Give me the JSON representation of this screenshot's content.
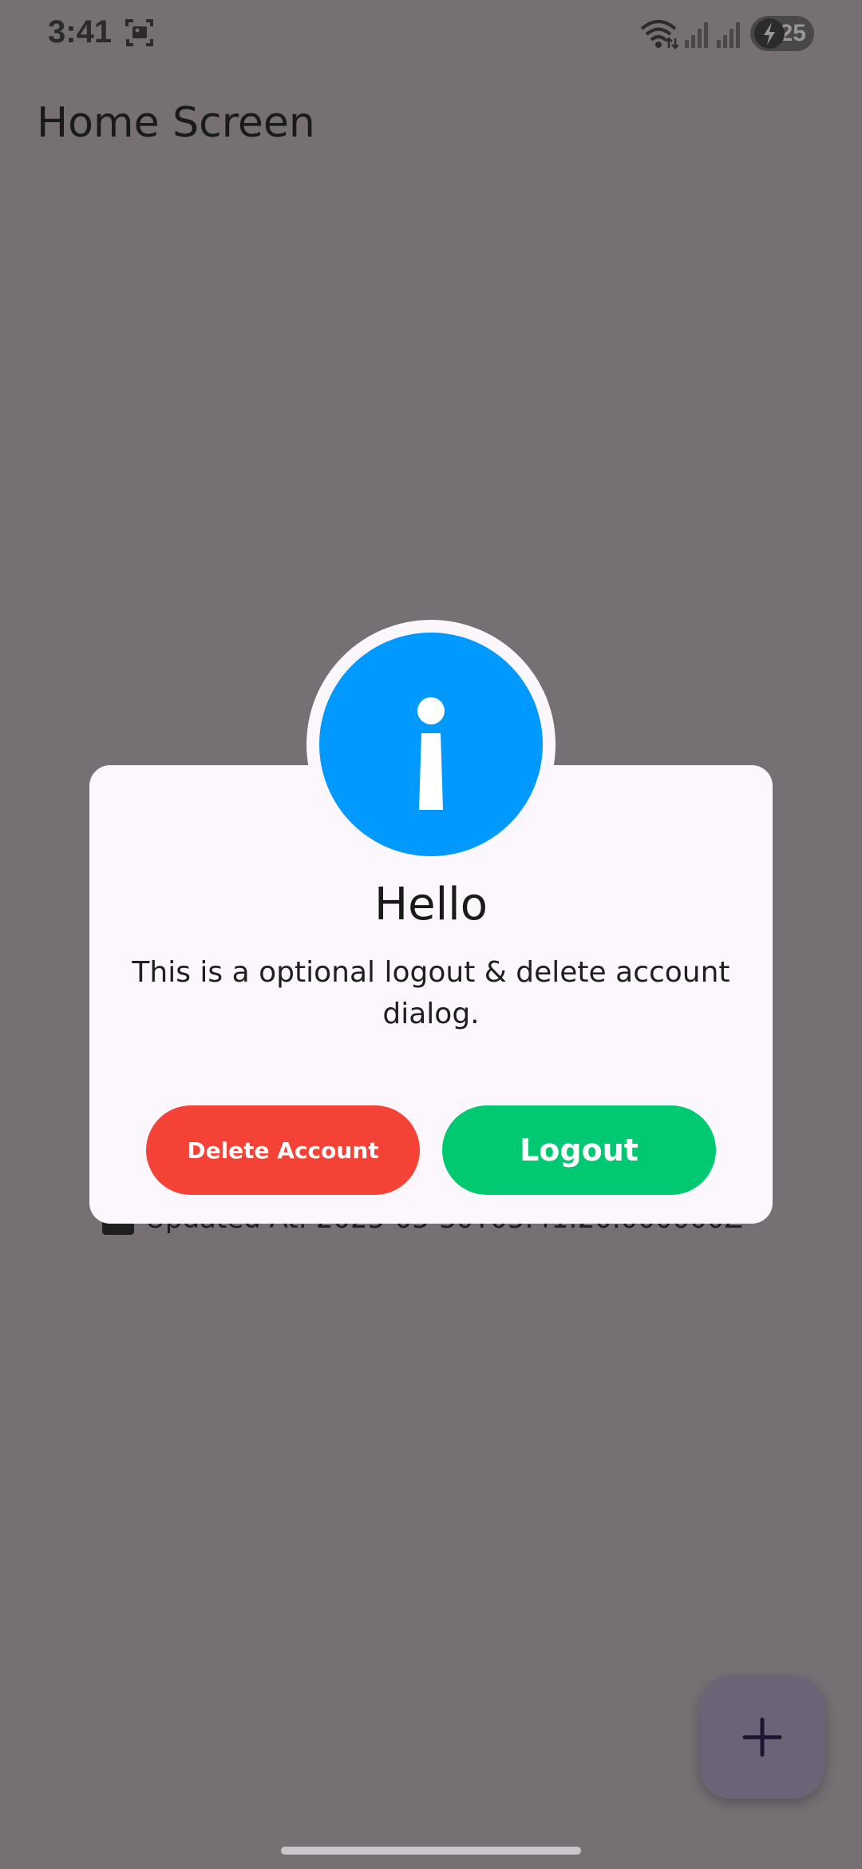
{
  "status_bar": {
    "time": "3:41",
    "battery_level": "25",
    "icons": [
      "screenshot-icon",
      "wifi-icon",
      "signal-icon",
      "signal-icon",
      "charging-bolt-icon"
    ]
  },
  "app_bar": {
    "title": "Home Screen"
  },
  "background_item": {
    "text": "Updated At: 2025-05-30T05:41:20.000000Z"
  },
  "dialog": {
    "icon": "info-icon",
    "title": "Hello",
    "message": "This is a optional logout & delete account dialog.",
    "delete_button_label": "Delete Account",
    "logout_button_label": "Logout",
    "colors": {
      "icon_background": "#0099ff",
      "delete_button": "#f44336",
      "logout_button": "#00c972",
      "surface": "#fcf7fd"
    }
  },
  "fab": {
    "icon": "plus-icon"
  },
  "scrim_color": "#767074"
}
